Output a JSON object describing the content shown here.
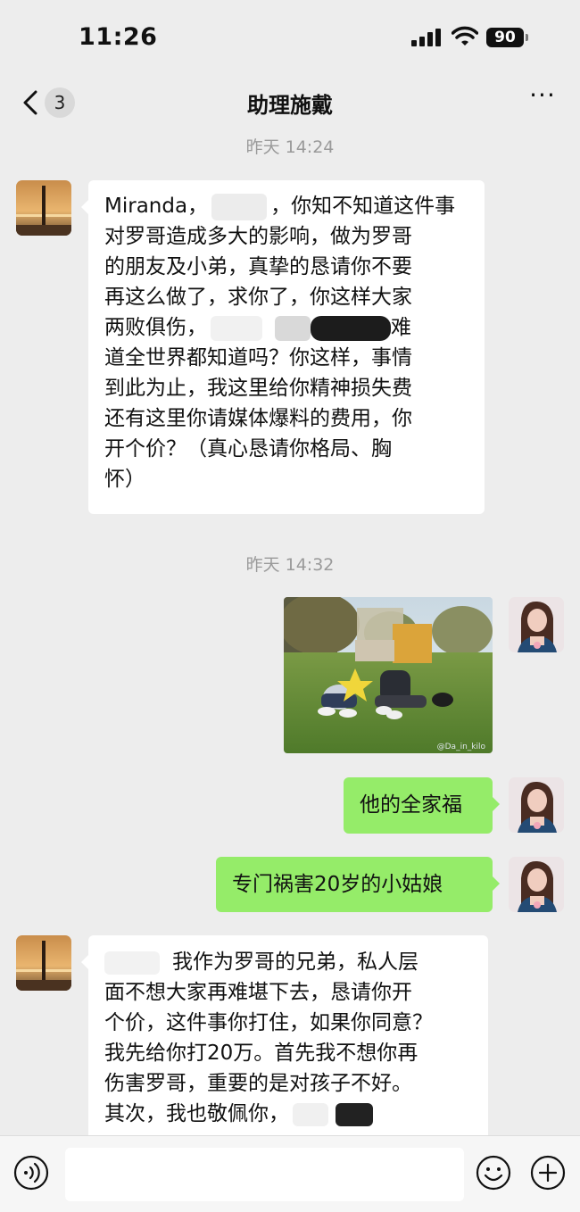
{
  "status_bar": {
    "time": "11:26",
    "battery": "90"
  },
  "nav": {
    "unread_count": "3",
    "title": "助理施戴",
    "more": "···"
  },
  "messages": [
    {
      "type": "timestamp",
      "text": "昨天 14:24"
    },
    {
      "type": "incoming_text",
      "lines": [
        {
          "a": "Miranda，",
          "b": "，你知不知道这件事"
        },
        {
          "a": "对罗哥造成多大的影响，做为罗哥"
        },
        {
          "a": "的朋友及小弟，真挚的恳请你不要"
        },
        {
          "a": "再这么做了，求你了，你这样大家"
        },
        {
          "a": "两败俱伤，",
          "b": "难"
        },
        {
          "a": "道全世界都知道吗？你这样，事情"
        },
        {
          "a": "到此为止，我这里给你精神损失费"
        },
        {
          "a": "还有这里你请媒体爆料的费用，你"
        },
        {
          "a": "开个价？（真心恳请你格局、胸"
        },
        {
          "a": "怀）"
        }
      ]
    },
    {
      "type": "timestamp",
      "text": "昨天 14:32"
    },
    {
      "type": "outgoing_image",
      "watermark": "@Da_in_kilo"
    },
    {
      "type": "outgoing_text",
      "text": "他的全家福"
    },
    {
      "type": "outgoing_text",
      "text": "专门祸害20岁的小姑娘"
    },
    {
      "type": "incoming_text",
      "lines": [
        {
          "a": "我作为罗哥的兄弟，私人层"
        },
        {
          "a": "面不想大家再难堪下去，恳请你开"
        },
        {
          "a": "个价，这件事你打住，如果你同意？"
        },
        {
          "a": "我先给你打20万。首先我不想你再"
        },
        {
          "a": "伤害罗哥，重要的是对孩子不好。"
        },
        {
          "a": "其次，我也敬佩你，"
        }
      ]
    }
  ],
  "input": {
    "placeholder": ""
  },
  "colors": {
    "bg": "#ededed",
    "incoming": "#ffffff",
    "outgoing": "#95ec69"
  },
  "icons": [
    "signal-icon",
    "wifi-icon",
    "back-chevron-icon",
    "more-icon",
    "voice-icon",
    "emoji-icon",
    "plus-icon"
  ]
}
